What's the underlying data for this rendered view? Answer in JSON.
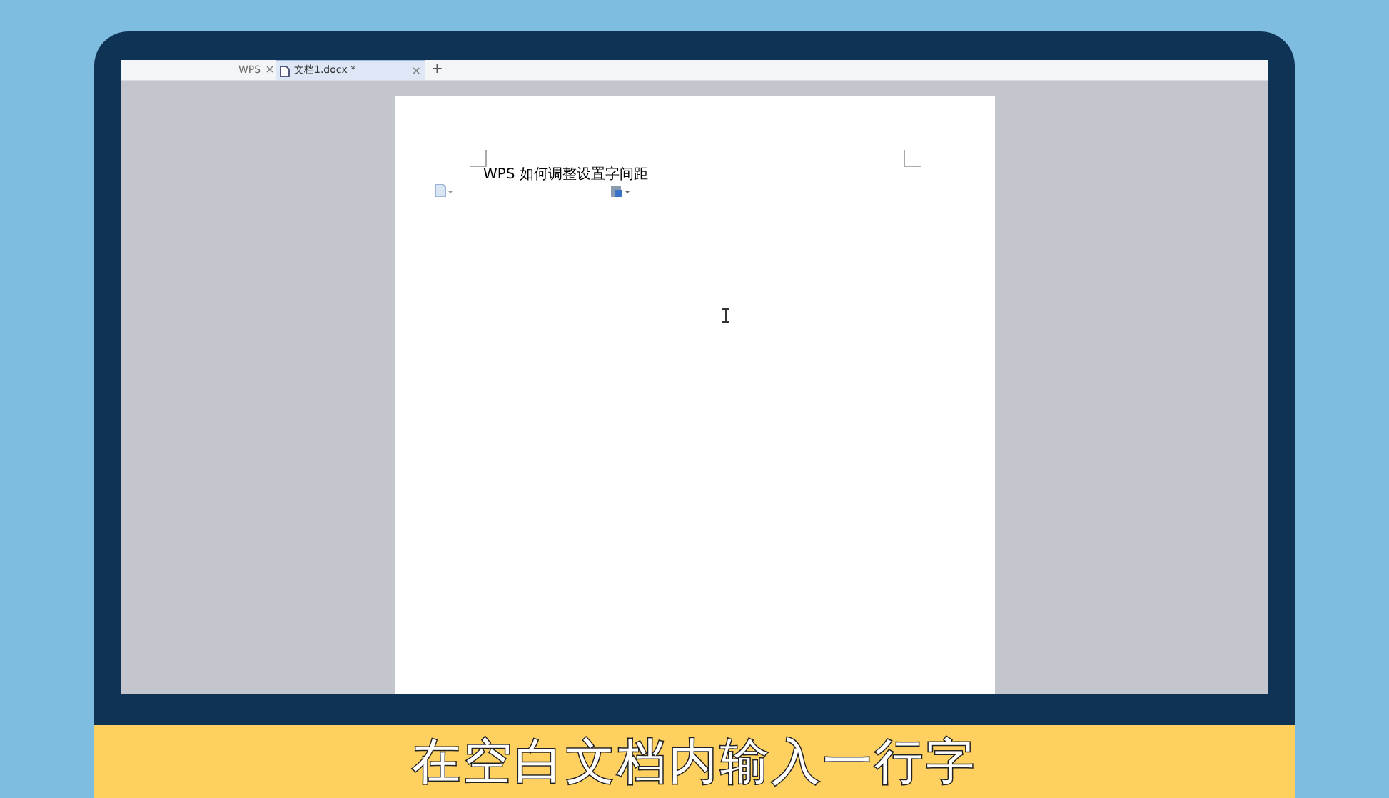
{
  "tabs": [
    {
      "label": "WPS",
      "close": "×",
      "selected": false
    },
    {
      "label": "文档1.docx *",
      "close": "×",
      "selected": true
    }
  ],
  "new_tab": "+",
  "document": {
    "text": "WPS 如何调整设置字间距"
  },
  "caption": "在空白文档内输入一行字"
}
